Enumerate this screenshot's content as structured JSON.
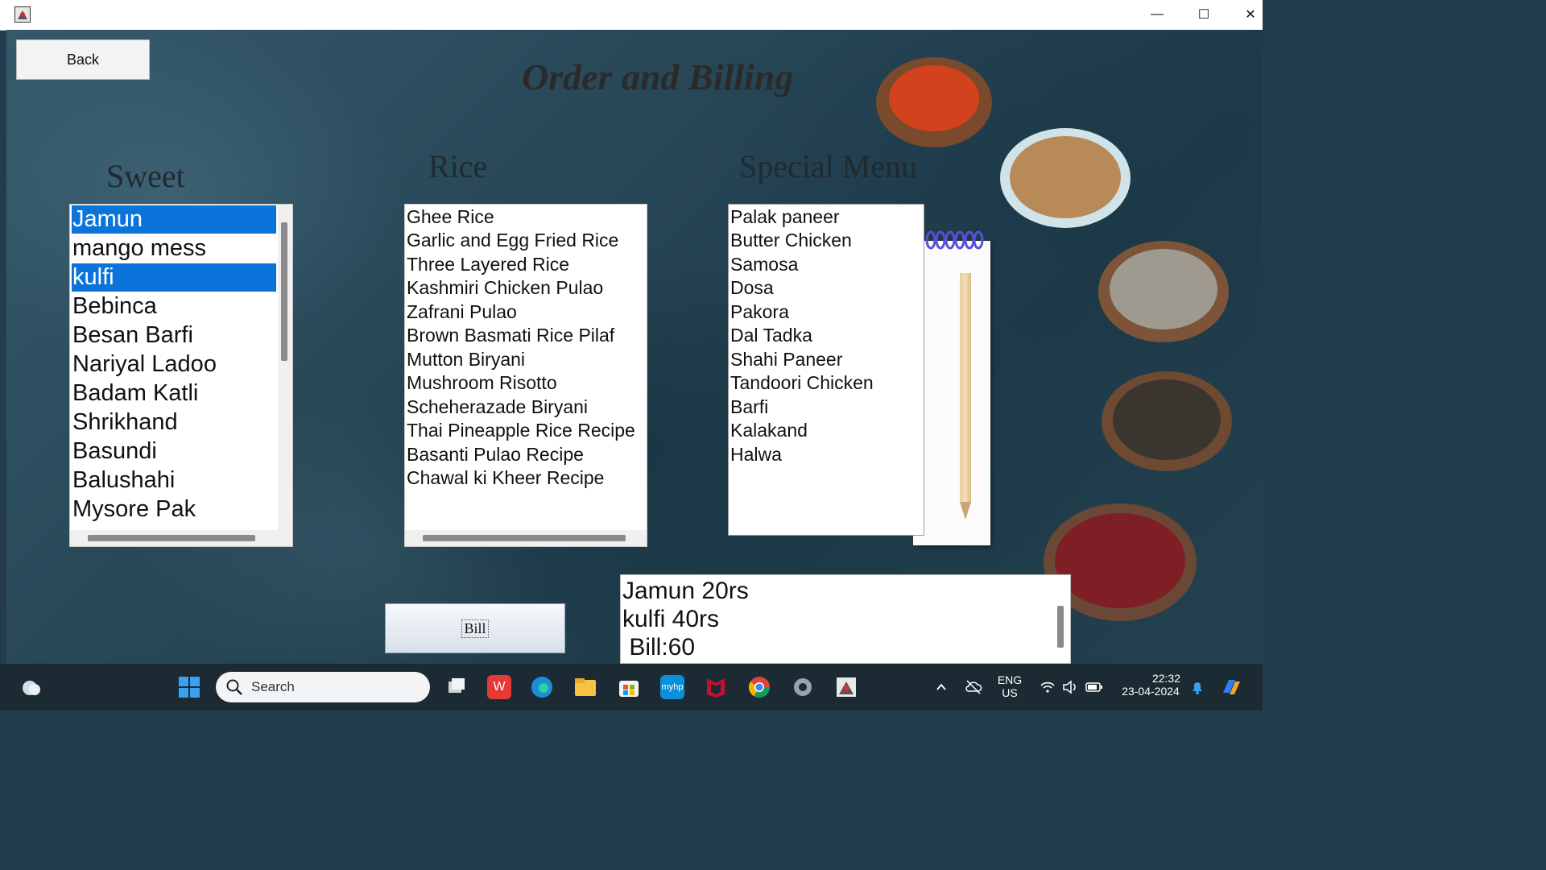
{
  "window": {
    "minimize_glyph": "—",
    "maximize_glyph": "☐",
    "close_glyph": "✕"
  },
  "header": {
    "back_label": "Back",
    "title": "Order and Billing"
  },
  "sections": {
    "sweet": {
      "title": "Sweet",
      "items": [
        "Jamun",
        "mango mess",
        "kulfi",
        "Bebinca",
        "Besan Barfi",
        "Nariyal Ladoo",
        "Badam Katli",
        "Shrikhand",
        "Basundi",
        "Balushahi",
        "Mysore Pak"
      ],
      "selected": [
        "Jamun",
        "kulfi"
      ]
    },
    "rice": {
      "title": "Rice",
      "items": [
        "Ghee Rice",
        "Garlic and Egg Fried Rice",
        "Three Layered Rice",
        "Kashmiri Chicken Pulao",
        "Zafrani Pulao",
        "Brown Basmati Rice Pilaf",
        "Mutton Biryani",
        "Mushroom Risotto",
        "Scheherazade Biryani",
        "Thai Pineapple Rice Recipe",
        "Basanti Pulao Recipe",
        "Chawal ki Kheer Recipe"
      ]
    },
    "special": {
      "title": "Special Menu",
      "items": [
        "Palak paneer",
        "Butter Chicken",
        "Samosa",
        "Dosa",
        "Pakora",
        "Dal Tadka",
        "Shahi Paneer",
        "Tandoori Chicken",
        "Barfi",
        "Kalakand",
        "Halwa"
      ]
    }
  },
  "billing": {
    "bill_button_label": "Bill",
    "output_lines": [
      "Jamun 20rs",
      "kulfi 40rs",
      " Bill:60"
    ]
  },
  "taskbar": {
    "search_label": "Search",
    "language_line1": "ENG",
    "language_line2": "US",
    "time": "22:32",
    "date": "23-04-2024",
    "icons": [
      "weather-icon",
      "start-icon",
      "task-view-icon",
      "wps-office-icon",
      "edge-icon",
      "file-explorer-icon",
      "microsoft-store-icon",
      "myhp-icon",
      "mcafee-icon",
      "chrome-icon",
      "settings-icon",
      "java-app-icon"
    ]
  },
  "colors": {
    "selection": "#0a74da",
    "background": "#243d4c",
    "taskbar": "#1c2b33"
  }
}
